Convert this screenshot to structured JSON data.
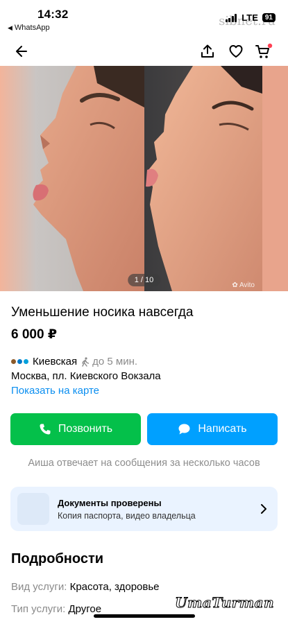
{
  "status_bar": {
    "time": "14:32",
    "back_app": "WhatsApp",
    "network": "LTE",
    "battery": "91",
    "site_watermark": "sibnet.ru"
  },
  "nav": {
    "back_icon": "arrow-left-icon",
    "share_icon": "share-icon",
    "favorite_icon": "heart-icon",
    "cart_icon": "cart-icon",
    "cart_badge_color": "#ff4053"
  },
  "gallery": {
    "counter": "1 / 10",
    "watermark": "Avito"
  },
  "listing": {
    "title": "Уменьшение носика навсегда",
    "price": "6 000 ₽"
  },
  "location": {
    "metro_colors": [
      "#8b5a2b",
      "#0078c8",
      "#00a0dc"
    ],
    "station": "Киевская",
    "walk_time": "до 5 мин.",
    "address": "Москва, пл. Киевского Вокзала",
    "map_link": "Показать на карте"
  },
  "actions": {
    "call_label": "Позвонить",
    "write_label": "Написать",
    "call_color": "#04c04a",
    "write_color": "#00a0ff"
  },
  "reply_note": "Аиша отвечает на сообщения за несколько часов",
  "documents": {
    "title": "Документы проверены",
    "subtitle": "Копия паспорта, видео владельца"
  },
  "details": {
    "heading": "Подробности",
    "rows": [
      {
        "key": "Вид услуги:",
        "value": "Красота, здоровье"
      },
      {
        "key": "Тип услуги:",
        "value": "Другое"
      }
    ]
  },
  "signature": "UmaTurman"
}
